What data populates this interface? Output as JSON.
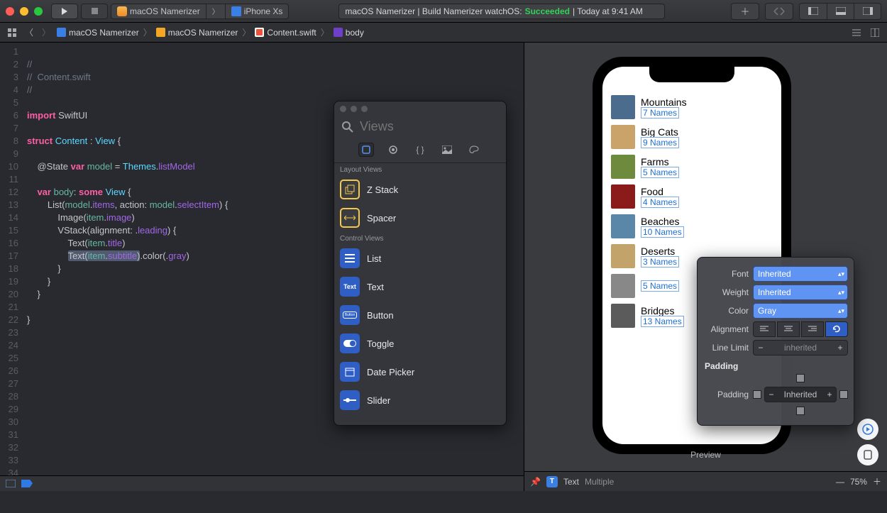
{
  "toolbar": {
    "scheme_target": "macOS Namerizer",
    "scheme_device": "iPhone Xs",
    "status_prefix": "macOS Namerizer | Build Namerizer watchOS:",
    "status_result": "Succeeded",
    "status_time": "| Today at 9:41 AM"
  },
  "breadcrumbs": {
    "project": "macOS Namerizer",
    "folder": "macOS Namerizer",
    "file": "Content.swift",
    "symbol": "body"
  },
  "code": {
    "lines": 35,
    "l1": "//",
    "l2": "//  Content.swift",
    "l3": "//",
    "l4": "",
    "l5a": "import",
    "l5b": " SwiftUI",
    "l6": "",
    "l7a": "struct",
    "l7b": " Content",
    "l7c": " : ",
    "l7d": "View",
    "l7e": " {",
    "l8": "",
    "l9a": "    @State ",
    "l9b": "var",
    "l9c": " model",
    "l9d": " = ",
    "l9e": "Themes",
    "l9f": ".",
    "l9g": "listModel",
    "l10": "",
    "l11a": "    ",
    "l11b": "var",
    "l11c": " body",
    "l11d": ": ",
    "l11e": "some",
    "l11f": " View",
    "l11g": " {",
    "l12a": "        List(",
    "l12b": "model",
    "l12c": ".",
    "l12d": "items",
    "l12e": ", action: ",
    "l12f": "model",
    "l12g": ".",
    "l12h": "selectItem",
    "l12i": ") {",
    "l13a": "            Image(",
    "l13b": "item",
    "l13c": ".",
    "l13d": "image",
    "l13e": ")",
    "l14a": "            VStack(alignment: .",
    "l14b": "leading",
    "l14c": ") {",
    "l15a": "                Text(",
    "l15b": "item",
    "l15c": ".",
    "l15d": "title",
    "l15e": ")",
    "l16a": "                ",
    "l16b": "Text(",
    "l16c": "item",
    "l16d": ".",
    "l16e": "subtitle",
    "l16f": ")",
    "l16g": ".color(.",
    "l16h": "gray",
    "l16i": ")",
    "l17": "            }",
    "l18": "        }",
    "l19": "    }",
    "l20": "",
    "l21": "}"
  },
  "library": {
    "search_placeholder": "Views",
    "section_layout": "Layout Views",
    "section_control": "Control Views",
    "items": {
      "zstack": "Z Stack",
      "spacer": "Spacer",
      "list": "List",
      "text": "Text",
      "button": "Button",
      "toggle": "Toggle",
      "datepicker": "Date Picker",
      "slider": "Slider"
    }
  },
  "preview": {
    "label": "Preview",
    "zoom": "75%",
    "rows": [
      {
        "title": "Mountains",
        "sub": "7 Names",
        "color": "#4b6c8c"
      },
      {
        "title": "Big Cats",
        "sub": "9 Names",
        "color": "#caa36b"
      },
      {
        "title": "Farms",
        "sub": "5 Names",
        "color": "#6e8b3d"
      },
      {
        "title": "Food",
        "sub": "4 Names",
        "color": "#8b1a1a"
      },
      {
        "title": "Beaches",
        "sub": "10 Names",
        "color": "#5a86a8"
      },
      {
        "title": "Deserts",
        "sub": "3 Names",
        "color": "#c2a46b"
      },
      {
        "title": "",
        "sub": "5 Names",
        "color": "#888"
      },
      {
        "title": "Bridges",
        "sub": "13 Names",
        "color": "#5b5b5b"
      }
    ],
    "selection_type": "Text",
    "selection_detail": "Multiple"
  },
  "inspector": {
    "font_label": "Font",
    "font_value": "Inherited",
    "weight_label": "Weight",
    "weight_value": "Inherited",
    "color_label": "Color",
    "color_value": "Gray",
    "align_label": "Alignment",
    "limit_label": "Line Limit",
    "limit_value": "inherited",
    "padding_header": "Padding",
    "padding_label": "Padding",
    "padding_value": "Inherited"
  }
}
